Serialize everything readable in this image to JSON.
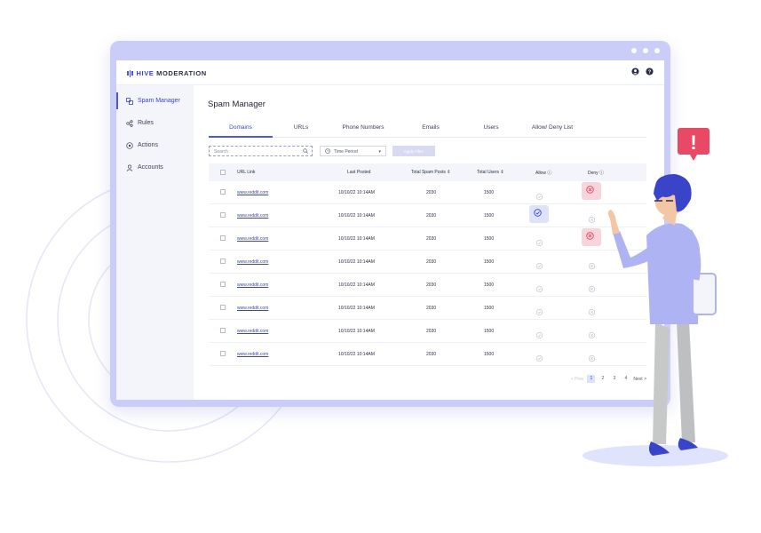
{
  "app": {
    "logo_mark": "HIVE",
    "logo_text": "MODERATION",
    "top_icons": [
      "user-icon",
      "help-icon"
    ]
  },
  "sidebar": {
    "items": [
      {
        "label": "Spam Manager",
        "icon": "spam-icon",
        "active": true
      },
      {
        "label": "Rules",
        "icon": "rules-icon",
        "active": false
      },
      {
        "label": "Actions",
        "icon": "actions-icon",
        "active": false
      },
      {
        "label": "Accounts",
        "icon": "user-icon",
        "active": false
      }
    ]
  },
  "main": {
    "title": "Spam Manager",
    "tabs": [
      {
        "label": "Domains",
        "active": true
      },
      {
        "label": "URLs",
        "active": false
      },
      {
        "label": "Phone Numbers",
        "active": false
      },
      {
        "label": "Emails",
        "active": false
      },
      {
        "label": "Users",
        "active": false
      },
      {
        "label": "Allow/ Deny List",
        "active": false
      }
    ],
    "search_placeholder": "Search",
    "time_period": "Time Period",
    "apply_label": "Apply Filter"
  },
  "table": {
    "headers": {
      "url": "URL Link",
      "posted": "Last Posted",
      "spam": "Total Spam Posts",
      "users": "Total Users",
      "allow": "Allow",
      "deny": "Deny"
    },
    "rows": [
      {
        "url": "www.reddit.com",
        "posted": "10/10/22 10:14AM",
        "spam": "2030",
        "users": "1500",
        "state": "deny"
      },
      {
        "url": "www.reddit.com",
        "posted": "10/10/22 10:14AM",
        "spam": "2030",
        "users": "1500",
        "state": "allow"
      },
      {
        "url": "www.reddit.com",
        "posted": "10/10/22 10:14AM",
        "spam": "2030",
        "users": "1500",
        "state": "deny"
      },
      {
        "url": "www.reddit.com",
        "posted": "10/10/22 10:14AM",
        "spam": "2030",
        "users": "1500",
        "state": "none"
      },
      {
        "url": "www.reddit.com",
        "posted": "10/10/22 10:14AM",
        "spam": "2030",
        "users": "1500",
        "state": "none"
      },
      {
        "url": "www.reddit.com",
        "posted": "10/10/22 10:14AM",
        "spam": "2030",
        "users": "1500",
        "state": "none"
      },
      {
        "url": "www.reddit.com",
        "posted": "10/10/22 10:14AM",
        "spam": "2030",
        "users": "1500",
        "state": "none"
      },
      {
        "url": "www.reddit.com",
        "posted": "10/10/22 10:14AM",
        "spam": "2030",
        "users": "1500",
        "state": "none"
      }
    ]
  },
  "pagination": {
    "prev": "< Prev",
    "pages": [
      "1",
      "2",
      "3",
      "4"
    ],
    "current": "1",
    "next": "Next >"
  },
  "illustration": {
    "alert_mark": "!"
  },
  "colors": {
    "accent": "#4b57e0",
    "frame": "#c9cdf7",
    "deny": "#e2405c",
    "deny_bg": "#f8d5dc",
    "allow_bg": "#dde3fb",
    "alert": "#e84a66"
  }
}
